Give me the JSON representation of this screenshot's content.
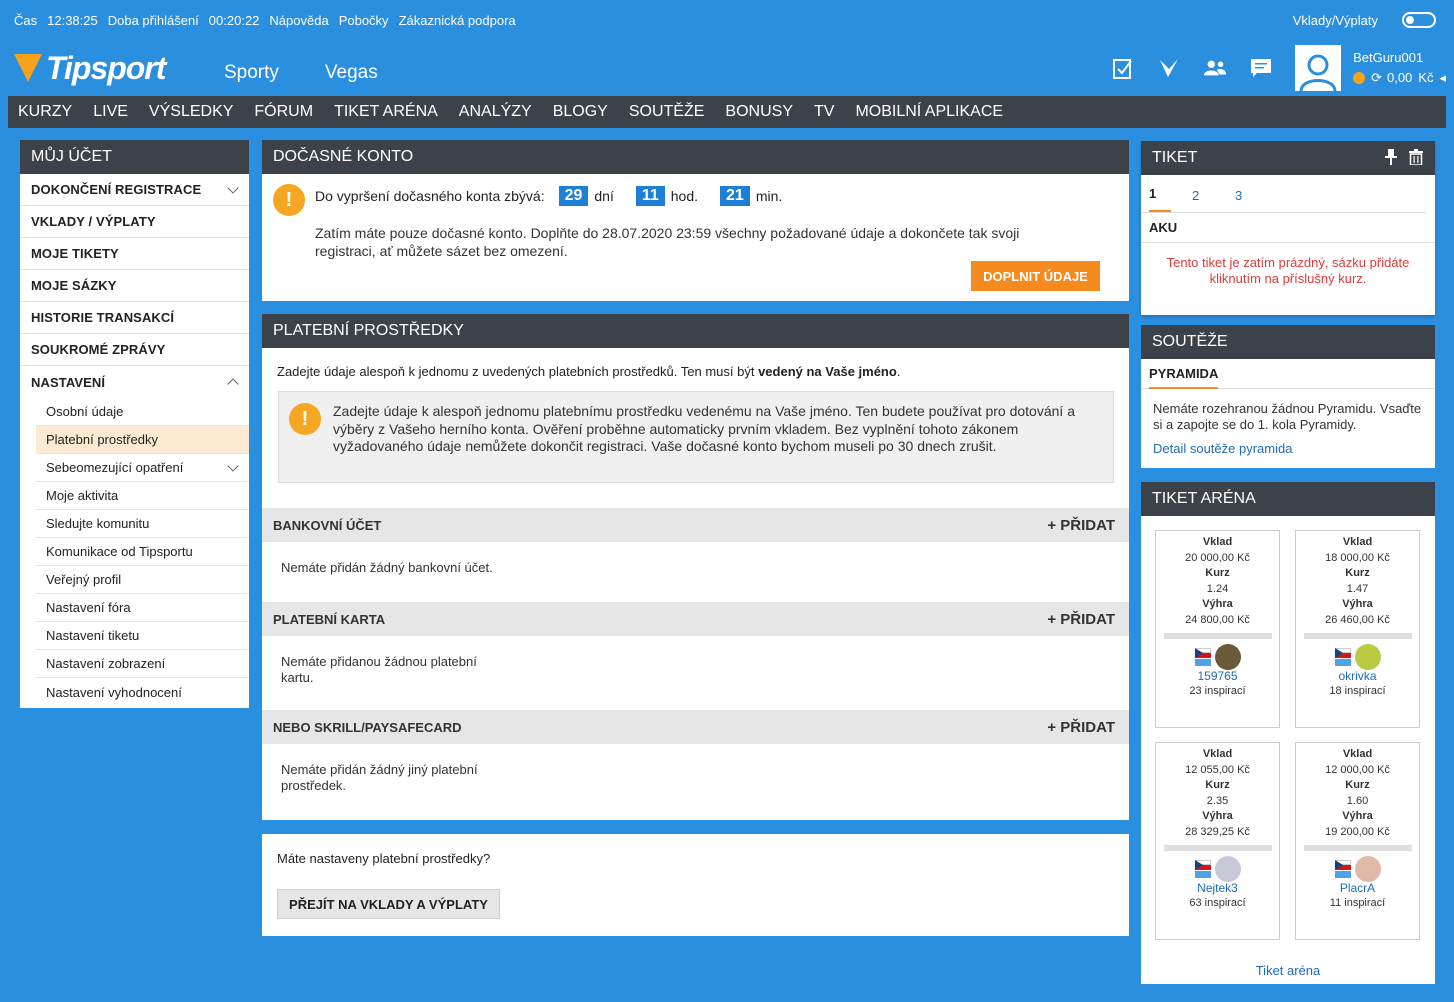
{
  "topbar": {
    "time_label": "Čas",
    "time_value": "12:38:25",
    "login_label": "Doba přihlášení",
    "login_value": "00:20:22",
    "help": "Nápověda",
    "branches": "Pobočky",
    "support": "Zákaznická podpora",
    "deposits_toggle": "Vklady/Výplaty"
  },
  "header": {
    "logo": "Tipsport",
    "nav": [
      "Sporty",
      "Vegas"
    ],
    "username": "BetGuru001",
    "balance": "0,00",
    "currency": "Kč"
  },
  "navbar": [
    "KURZY",
    "LIVE",
    "VÝSLEDKY",
    "FÓRUM",
    "TIKET ARÉNA",
    "ANALÝZY",
    "BLOGY",
    "SOUTĚŽE",
    "BONUSY",
    "TV",
    "MOBILNÍ APLIKACE"
  ],
  "account": {
    "title": "MŮJ ÚČET",
    "items": [
      "DOKONČENÍ REGISTRACE",
      "VKLADY / VÝPLATY",
      "MOJE TIKETY",
      "MOJE SÁZKY",
      "HISTORIE TRANSAKCÍ",
      "SOUKROMÉ ZPRÁVY",
      "NASTAVENÍ"
    ],
    "settings": [
      "Osobní údaje",
      "Platební prostředky",
      "Sebeomezující opatření",
      "Moje aktivita",
      "Sledujte komunitu",
      "Komunikace od Tipsportu",
      "Veřejný profil",
      "Nastavení fóra",
      "Nastavení tiketu",
      "Nastavení zobrazení",
      "Nastavení vyhodnocení"
    ]
  },
  "temp": {
    "title": "DOČASNÉ KONTO",
    "countdown_label": "Do vypršení dočasného konta zbývá:",
    "days": "29",
    "days_unit": "dní",
    "hours": "11",
    "hours_unit": "hod.",
    "minutes": "21",
    "minutes_unit": "min.",
    "text": "Zatím máte pouze dočasné konto. Doplňte do 28.07.2020 23:59 všechny požadované údaje a dokončete tak svoji registraci, ať můžete sázet bez omezení.",
    "button": "DOPLNIT ÚDAJE"
  },
  "payment": {
    "title": "PLATEBNÍ PROSTŘEDKY",
    "intro": "Zadejte údaje alespoň k jednomu z uvedených platebních prostředků. Ten musí být",
    "intro_bold": "vedený na Vaše jméno",
    "intro_end": ".",
    "warn_text": "Zadejte údaje k alespoň jednomu platebnímu prostředku vedenému na Vaše jméno. Ten budete používat pro dotování a výběry z Vašeho herního konta. Ověření proběhne automaticky prvním vkladem. Bez vyplnění tohoto zákonem vyžadovaného údaje nemůžete dokončit registraci. Vaše dočasné konto bychom museli po 30 dnech zrušit.",
    "add": "+ PŘIDAT",
    "bank": {
      "title": "BANKOVNÍ ÚČET",
      "empty": "Nemáte přidán žádný bankovní účet."
    },
    "card": {
      "title": "PLATEBNÍ KARTA",
      "empty": "Nemáte přidanou žádnou platební kartu."
    },
    "other": {
      "title": "NEBO SKRILL/PAYSAFECARD",
      "empty": "Nemáte přidán žádný jiný platební prostředek."
    }
  },
  "settings_box": {
    "question": "Máte nastaveny platební prostředky?",
    "button": "PŘEJÍT NA VKLADY A VÝPLATY"
  },
  "ticket": {
    "title": "TIKET",
    "tabs": [
      "1",
      "2",
      "3"
    ],
    "type": "AKU",
    "empty": "Tento tiket je zatím prázdný, sázku přidáte kliknutím na příslušný kurz."
  },
  "contests": {
    "title": "SOUTĚŽE",
    "tab": "PYRAMIDA",
    "text": "Nemáte rozehranou žádnou Pyramidu. Vsaďte si a zapojte se do 1. kola Pyramidy.",
    "link": "Detail soutěže pyramida"
  },
  "arena": {
    "title": "TIKET ARÉNA",
    "labels": {
      "stake": "Vklad",
      "odds": "Kurz",
      "win": "Výhra"
    },
    "cards": [
      {
        "stake": "20 000,00 Kč",
        "odds": "1.24",
        "win": "24 800,00 Kč",
        "user": "159765",
        "insp": "23 inspirací",
        "color": "#6b5a3a"
      },
      {
        "stake": "18 000,00 Kč",
        "odds": "1.47",
        "win": "26 460,00 Kč",
        "user": "okrivka",
        "insp": "18 inspirací",
        "color": "#b9c940"
      },
      {
        "stake": "12 055,00 Kč",
        "odds": "2.35",
        "win": "28 329,25 Kč",
        "user": "Nejtek3",
        "insp": "63 inspirací",
        "color": "#c8c8d8"
      },
      {
        "stake": "12 000,00 Kč",
        "odds": "1.60",
        "win": "19 200,00 Kč",
        "user": "PlacrA",
        "insp": "11 inspirací",
        "color": "#e0b8a8"
      }
    ],
    "link": "Tiket aréna"
  }
}
